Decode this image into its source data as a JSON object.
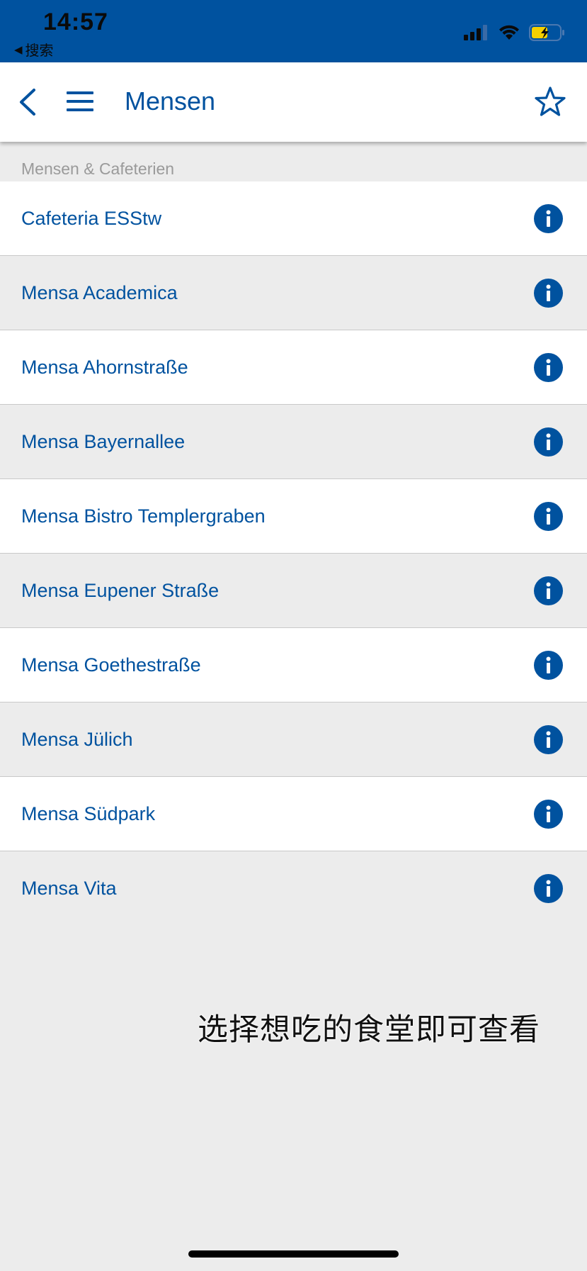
{
  "status_bar": {
    "time": "14:57",
    "back_app_label": "搜索",
    "background_color": "#00529f"
  },
  "header": {
    "title": "Mensen",
    "back_icon": "chevron-left-icon",
    "menu_icon": "hamburger-menu-icon",
    "favorite_icon": "star-outline-icon",
    "accent_color": "#00529f"
  },
  "section": {
    "title": "Mensen & Cafeterien"
  },
  "list": {
    "items": [
      {
        "label": "Cafeteria ESStw"
      },
      {
        "label": "Mensa Academica"
      },
      {
        "label": "Mensa Ahornstraße"
      },
      {
        "label": "Mensa Bayernallee"
      },
      {
        "label": "Mensa Bistro Templergraben"
      },
      {
        "label": "Mensa Eupener Straße"
      },
      {
        "label": "Mensa Goethestraße"
      },
      {
        "label": "Mensa Jülich"
      },
      {
        "label": "Mensa Südpark"
      },
      {
        "label": "Mensa Vita"
      }
    ],
    "item_icon": "info-icon"
  },
  "caption": {
    "text": "选择想吃的食堂即可查看"
  }
}
